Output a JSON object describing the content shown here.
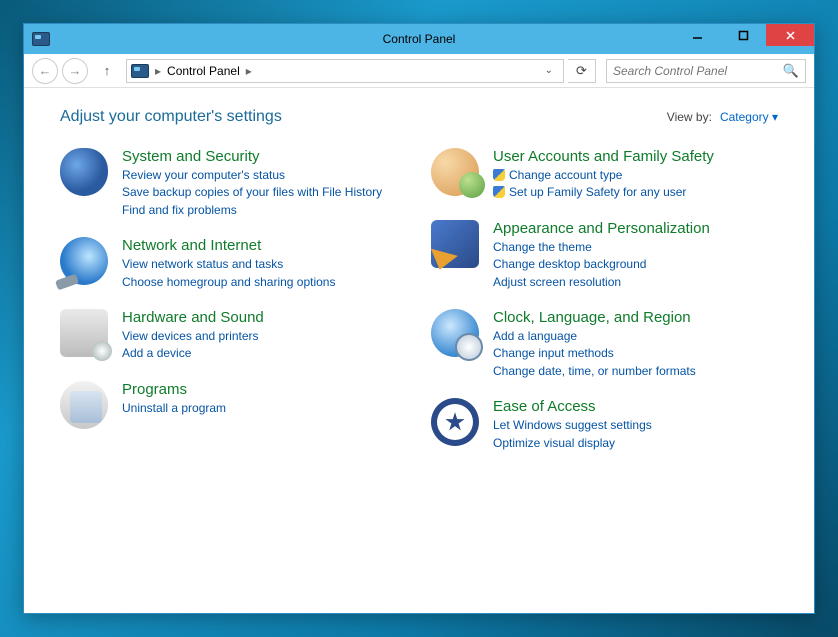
{
  "window": {
    "title": "Control Panel"
  },
  "address": {
    "root": "Control Panel"
  },
  "search": {
    "placeholder": "Search Control Panel"
  },
  "heading": "Adjust your computer's settings",
  "viewby": {
    "label": "View by:",
    "value": "Category"
  },
  "left": [
    {
      "icon": "security",
      "title": "System and Security",
      "links": [
        {
          "text": "Review your computer's status",
          "shield": false
        },
        {
          "text": "Save backup copies of your files with File History",
          "shield": false
        },
        {
          "text": "Find and fix problems",
          "shield": false
        }
      ]
    },
    {
      "icon": "network",
      "title": "Network and Internet",
      "links": [
        {
          "text": "View network status and tasks",
          "shield": false
        },
        {
          "text": "Choose homegroup and sharing options",
          "shield": false
        }
      ]
    },
    {
      "icon": "hardware",
      "title": "Hardware and Sound",
      "links": [
        {
          "text": "View devices and printers",
          "shield": false
        },
        {
          "text": "Add a device",
          "shield": false
        }
      ]
    },
    {
      "icon": "programs",
      "title": "Programs",
      "links": [
        {
          "text": "Uninstall a program",
          "shield": false
        }
      ]
    }
  ],
  "right": [
    {
      "icon": "users",
      "title": "User Accounts and Family Safety",
      "links": [
        {
          "text": "Change account type",
          "shield": true
        },
        {
          "text": "Set up Family Safety for any user",
          "shield": true
        }
      ]
    },
    {
      "icon": "appearance",
      "title": "Appearance and Personalization",
      "links": [
        {
          "text": "Change the theme",
          "shield": false
        },
        {
          "text": "Change desktop background",
          "shield": false
        },
        {
          "text": "Adjust screen resolution",
          "shield": false
        }
      ]
    },
    {
      "icon": "clock",
      "title": "Clock, Language, and Region",
      "links": [
        {
          "text": "Add a language",
          "shield": false
        },
        {
          "text": "Change input methods",
          "shield": false
        },
        {
          "text": "Change date, time, or number formats",
          "shield": false
        }
      ]
    },
    {
      "icon": "ease",
      "title": "Ease of Access",
      "links": [
        {
          "text": "Let Windows suggest settings",
          "shield": false
        },
        {
          "text": "Optimize visual display",
          "shield": false
        }
      ]
    }
  ]
}
